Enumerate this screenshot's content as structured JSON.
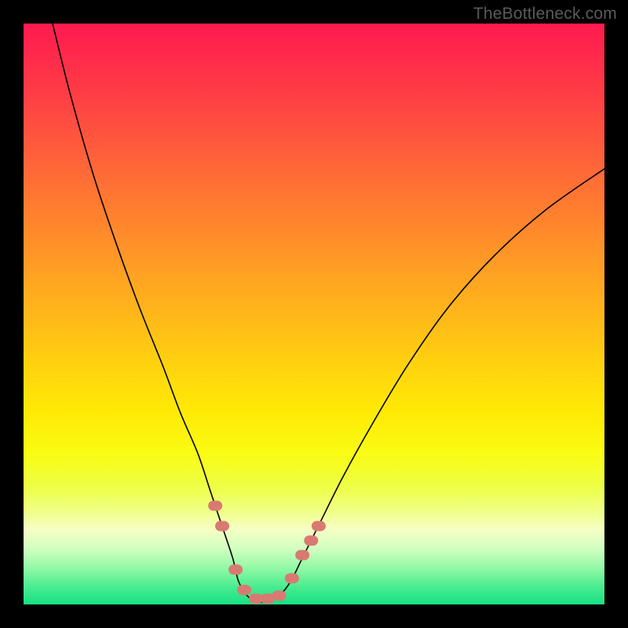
{
  "watermark": "TheBottleneck.com",
  "chart_data": {
    "type": "line",
    "title": "",
    "xlabel": "",
    "ylabel": "",
    "xlim": [
      0,
      100
    ],
    "ylim": [
      0,
      100
    ],
    "grid": false,
    "legend": false,
    "background": {
      "type": "vertical-gradient",
      "stops": [
        {
          "offset": 0.0,
          "color": "#ff1a4f"
        },
        {
          "offset": 0.06,
          "color": "#ff2b4b"
        },
        {
          "offset": 0.13,
          "color": "#ff4044"
        },
        {
          "offset": 0.2,
          "color": "#ff573d"
        },
        {
          "offset": 0.27,
          "color": "#ff6e35"
        },
        {
          "offset": 0.35,
          "color": "#ff872c"
        },
        {
          "offset": 0.43,
          "color": "#ffa122"
        },
        {
          "offset": 0.51,
          "color": "#ffba18"
        },
        {
          "offset": 0.59,
          "color": "#ffd30e"
        },
        {
          "offset": 0.67,
          "color": "#ffea05"
        },
        {
          "offset": 0.74,
          "color": "#fafc13"
        },
        {
          "offset": 0.8,
          "color": "#edff49"
        },
        {
          "offset": 0.84,
          "color": "#f0ff88"
        },
        {
          "offset": 0.87,
          "color": "#f6ffc4"
        },
        {
          "offset": 0.905,
          "color": "#cfffc0"
        },
        {
          "offset": 0.94,
          "color": "#8cf8a4"
        },
        {
          "offset": 0.97,
          "color": "#49ec90"
        },
        {
          "offset": 1.0,
          "color": "#16e183"
        }
      ]
    },
    "series": [
      {
        "name": "bottleneck-curve",
        "stroke": "#000000",
        "stroke_width": 1.6,
        "x": [
          5,
          8,
          12,
          16,
          20,
          24,
          27,
          30,
          32,
          34,
          36,
          37,
          38.5,
          40,
          42,
          44,
          46,
          48,
          51,
          55,
          60,
          66,
          73,
          81,
          90,
          100
        ],
        "y": [
          100,
          88,
          74,
          62,
          51,
          41,
          33,
          26,
          20,
          14,
          8,
          4,
          1.5,
          0.5,
          0.5,
          1.5,
          4,
          8,
          14,
          22,
          31,
          41,
          51,
          60,
          68,
          75
        ]
      }
    ],
    "markers": {
      "name": "highlight-points",
      "shape": "rounded-pill",
      "fill": "#d97a72",
      "points": [
        {
          "x": 33.0,
          "y": 17.0
        },
        {
          "x": 34.2,
          "y": 13.5
        },
        {
          "x": 36.5,
          "y": 6.0
        },
        {
          "x": 38.0,
          "y": 2.5
        },
        {
          "x": 40.0,
          "y": 1.0
        },
        {
          "x": 42.0,
          "y": 1.0
        },
        {
          "x": 44.0,
          "y": 1.5
        },
        {
          "x": 46.2,
          "y": 4.5
        },
        {
          "x": 48.0,
          "y": 8.5
        },
        {
          "x": 49.5,
          "y": 11.0
        },
        {
          "x": 50.8,
          "y": 13.5
        }
      ]
    }
  }
}
